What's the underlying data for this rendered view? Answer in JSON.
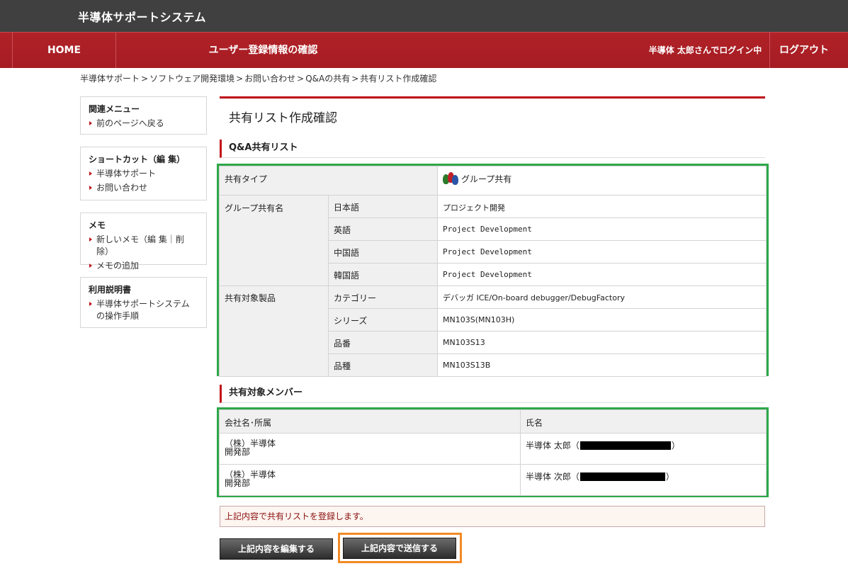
{
  "app": {
    "title": "半導体サポートシステム"
  },
  "nav": {
    "home": "HOME",
    "page": "ユーザー登録情報の確認",
    "user_status": "半導体 太郎さんでログイン中",
    "logout": "ログアウト"
  },
  "breadcrumb": [
    "半導体サポート",
    "ソフトウェア開発環境",
    "お問い合わせ",
    "Q&Aの共有",
    "共有リスト作成確認"
  ],
  "sidebar": [
    {
      "title": "関連メニュー",
      "items": [
        "前のページへ戻る"
      ]
    },
    {
      "title": "ショートカット（編 集）",
      "items": [
        "半導体サポート",
        "お問い合わせ"
      ]
    },
    {
      "title": "メモ",
      "items": [
        "新しいメモ（編 集｜削 除）",
        "メモの追加"
      ]
    },
    {
      "title": "利用説明書",
      "items": [
        "半導体サポートシステムの操作手順"
      ]
    }
  ],
  "main": {
    "title": "共有リスト作成確認",
    "qa_section": {
      "heading": "Q&A共有リスト",
      "share_type_label": "共有タイプ",
      "share_type_value": "グループ共有",
      "group_name_label": "グループ共有名",
      "languages": [
        {
          "label": "日本語",
          "value": "プロジェクト開発"
        },
        {
          "label": "英語",
          "value": "Project Development"
        },
        {
          "label": "中国語",
          "value": "Project Development"
        },
        {
          "label": "韓国語",
          "value": "Project Development"
        }
      ],
      "product_label": "共有対象製品",
      "products": [
        {
          "label": "カテゴリー",
          "value": "デバッガ ICE/On-board debugger/DebugFactory"
        },
        {
          "label": "シリーズ",
          "value": "MN103S(MN103H)"
        },
        {
          "label": "品番",
          "value": "MN103S13"
        },
        {
          "label": "品種",
          "value": "MN103S13B"
        }
      ]
    },
    "members_section": {
      "heading": "共有対象メンバー",
      "col_company": "会社名･所属",
      "col_name": "氏名",
      "rows": [
        {
          "company": "（株）半導体",
          "dept": "開発部",
          "name": "半導体 太郎（",
          "close": "）"
        },
        {
          "company": "（株）半導体",
          "dept": "開発部",
          "name": "半導体 次郎（",
          "close": "）"
        }
      ]
    },
    "notice": "上記内容で共有リストを登録します。",
    "edit_button": "上記内容を編集する",
    "submit_button": "上記内容で送信する"
  },
  "colors": {
    "brand_red": "#a51c22",
    "highlight_green": "#2ea84a",
    "highlight_orange": "#f28a24"
  }
}
